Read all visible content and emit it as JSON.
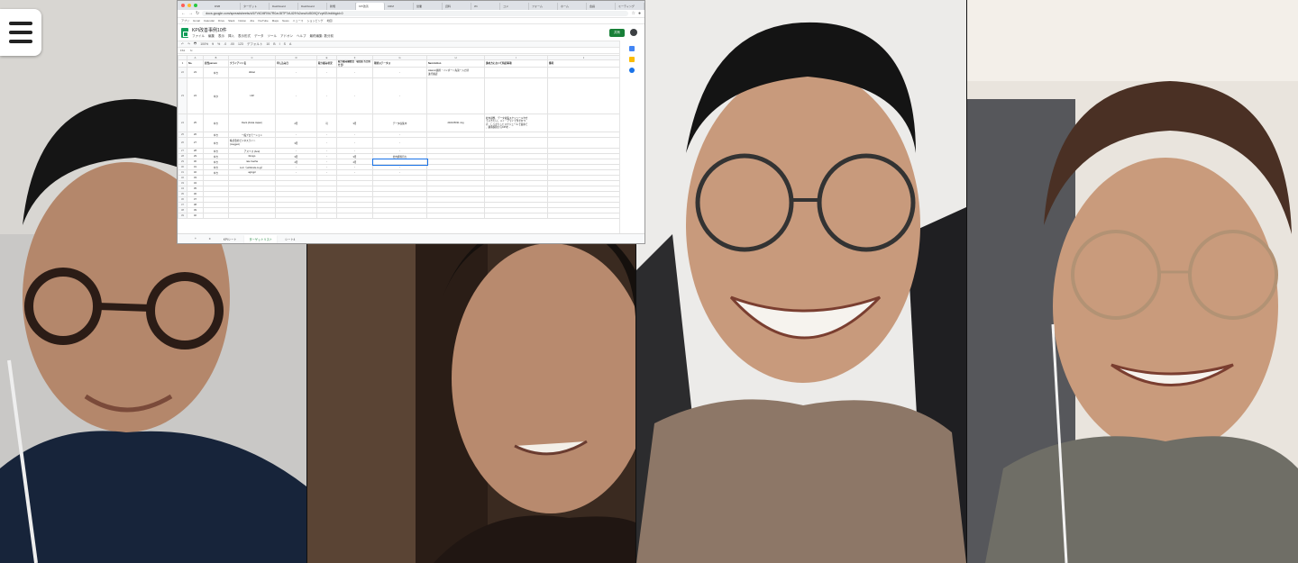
{
  "app": {
    "menu_icon": "hamburger-icon"
  },
  "participants": [
    {
      "name": "",
      "description": "person with round dark glasses, earphones, navy shirt"
    },
    {
      "name": "",
      "description": "person in dark shirt looking to the side"
    },
    {
      "name": "",
      "description": "person with glasses in a gaming chair, beige sweater"
    },
    {
      "name": "",
      "description": "person with round wire glasses, earphones, grey shirt"
    }
  ],
  "browser": {
    "tabs": [
      "DSB",
      "ターゲット",
      "Dashboard",
      "Dashboard",
      "新規",
      "KPI改善",
      "CRM",
      "営業",
      "資料",
      "Wi",
      "コメ",
      "フォーム",
      "ホーム",
      "会議",
      "ミーティング",
      "チャット"
    ],
    "active_tab_index": 5,
    "url": "docs.google.com/spreadsheets/d/1FVtCMRVk7R0zrJ8TP7dUl2fYk2cnuKd5D9QYzpKE/edit#gid=0",
    "bookmarks": [
      "アプリ",
      "Gmail",
      "Calendar",
      "Drive",
      "Slack",
      "Notion",
      "Jira",
      "YouTube",
      "Maps",
      "News",
      "ニュース",
      "ショッピング",
      "地図"
    ]
  },
  "sheet": {
    "title": "KPI改善事例10件",
    "menus": [
      "ファイル",
      "編集",
      "表示",
      "挿入",
      "表示形式",
      "データ",
      "ツール",
      "アドオン",
      "ヘルプ",
      "最終編集: 数分前"
    ],
    "share_label": "共有",
    "toolbar": [
      "↶",
      "↷",
      "🖶",
      "100%",
      "¥",
      "%",
      ".0",
      ".00",
      "123",
      "デフォルト",
      "10",
      "B",
      "I",
      "S",
      "A"
    ],
    "cell_ref": "F61",
    "col_letters": [
      "A",
      "B",
      "C",
      "D",
      "E",
      "F",
      "G",
      "H",
      "I",
      "J"
    ],
    "headers": [
      "No.",
      "担当person",
      "クライアント名",
      "申し込み日",
      "取り組み状況",
      "取り組み開始日（初回打ち合わせ日）",
      "現状ステータス",
      "Next Action",
      "進め方において特記事項",
      "備考"
    ],
    "rows": [
      {
        "rn": "22",
        "cells": [
          "23",
          "ゆき",
          "dkfuel",
          "-",
          "-",
          "-",
          "-",
          "Akaruni連携・インポート先第一入力済\n進行確認",
          "",
          ""
        ]
      },
      {
        "rn": "23",
        "cells": [
          "24",
          "ゆか",
          "LIM",
          "-",
          "-",
          "-",
          "-",
          "",
          "",
          ""
        ]
      },
      {
        "rn": "24",
        "cells": [
          "25",
          "ゆき",
          "Deck (Arista Japan)",
          "2月",
          "可",
          "3月",
          "データ収集中",
          "2021/05/31 mtg",
          "社内調整、データ収集スケジュールや方\nていきたい。メイ・アライでタ手をつ\nけ、しっかりしたスケジュールで進めて\n、顧客個別からKPIを...",
          ""
        ]
      },
      {
        "rn": "25",
        "cells": [
          "26",
          "ゆき",
          "一般プロモーション",
          "-",
          "-",
          "-",
          "-",
          "",
          "",
          ""
        ]
      },
      {
        "rn": "26",
        "cells": [
          "27",
          "ゆき",
          "株式会社ビジネスライト\n(meggen)",
          "3月",
          "-",
          "-",
          "-",
          "",
          "",
          ""
        ]
      },
      {
        "rn": "27",
        "cells": [
          "28",
          "ゆき",
          "アスミス (Arai)",
          "-",
          "-",
          "-",
          "-",
          "",
          "",
          ""
        ]
      },
      {
        "rn": "28",
        "cells": [
          "29",
          "ゆき",
          "Rengo",
          "3月",
          "-",
          "3月",
          "社内資料待ち",
          "",
          "",
          ""
        ]
      },
      {
        "rn": "29",
        "cells": [
          "30",
          "ゆき",
          "rate Inacha",
          "4月",
          "-",
          "4月",
          "",
          "",
          "",
          ""
        ]
      },
      {
        "rn": "30",
        "cells": [
          "31",
          "ゆき",
          "LLC（softfonds.co.jp）",
          "-",
          "-",
          "-",
          "-",
          "",
          "",
          ""
        ]
      },
      {
        "rn": "31",
        "cells": [
          "32",
          "ゆき",
          "agingpl",
          "-",
          "-",
          "-",
          "-",
          "",
          "",
          ""
        ]
      },
      {
        "rn": "32",
        "cells": [
          "33",
          "",
          "",
          "",
          "",
          "",
          "",
          "",
          "",
          ""
        ]
      },
      {
        "rn": "33",
        "cells": [
          "34",
          "",
          "",
          "",
          "",
          "",
          "",
          "",
          "",
          ""
        ]
      },
      {
        "rn": "34",
        "cells": [
          "35",
          "",
          "",
          "",
          "",
          "",
          "",
          "",
          "",
          ""
        ]
      },
      {
        "rn": "35",
        "cells": [
          "36",
          "",
          "",
          "",
          "",
          "",
          "",
          "",
          "",
          ""
        ]
      },
      {
        "rn": "36",
        "cells": [
          "37",
          "",
          "",
          "",
          "",
          "",
          "",
          "",
          "",
          ""
        ]
      },
      {
        "rn": "37",
        "cells": [
          "38",
          "",
          "",
          "",
          "",
          "",
          "",
          "",
          "",
          ""
        ]
      },
      {
        "rn": "38",
        "cells": [
          "39",
          "",
          "",
          "",
          "",
          "",
          "",
          "",
          "",
          ""
        ]
      },
      {
        "rn": "39",
        "cells": [
          "40",
          "",
          "",
          "",
          "",
          "",
          "",
          "",
          "",
          ""
        ]
      }
    ],
    "sheet_tabs": [
      "+",
      "≡",
      "KPIシート",
      "ターゲットリスト",
      "シート4"
    ],
    "active_sheet_tab": 3
  },
  "colors": {
    "sheets_green": "#188038",
    "selection_blue": "#1a73e8",
    "mac_red": "#ff5f57",
    "mac_yellow": "#febc2e",
    "mac_green": "#28c840"
  }
}
